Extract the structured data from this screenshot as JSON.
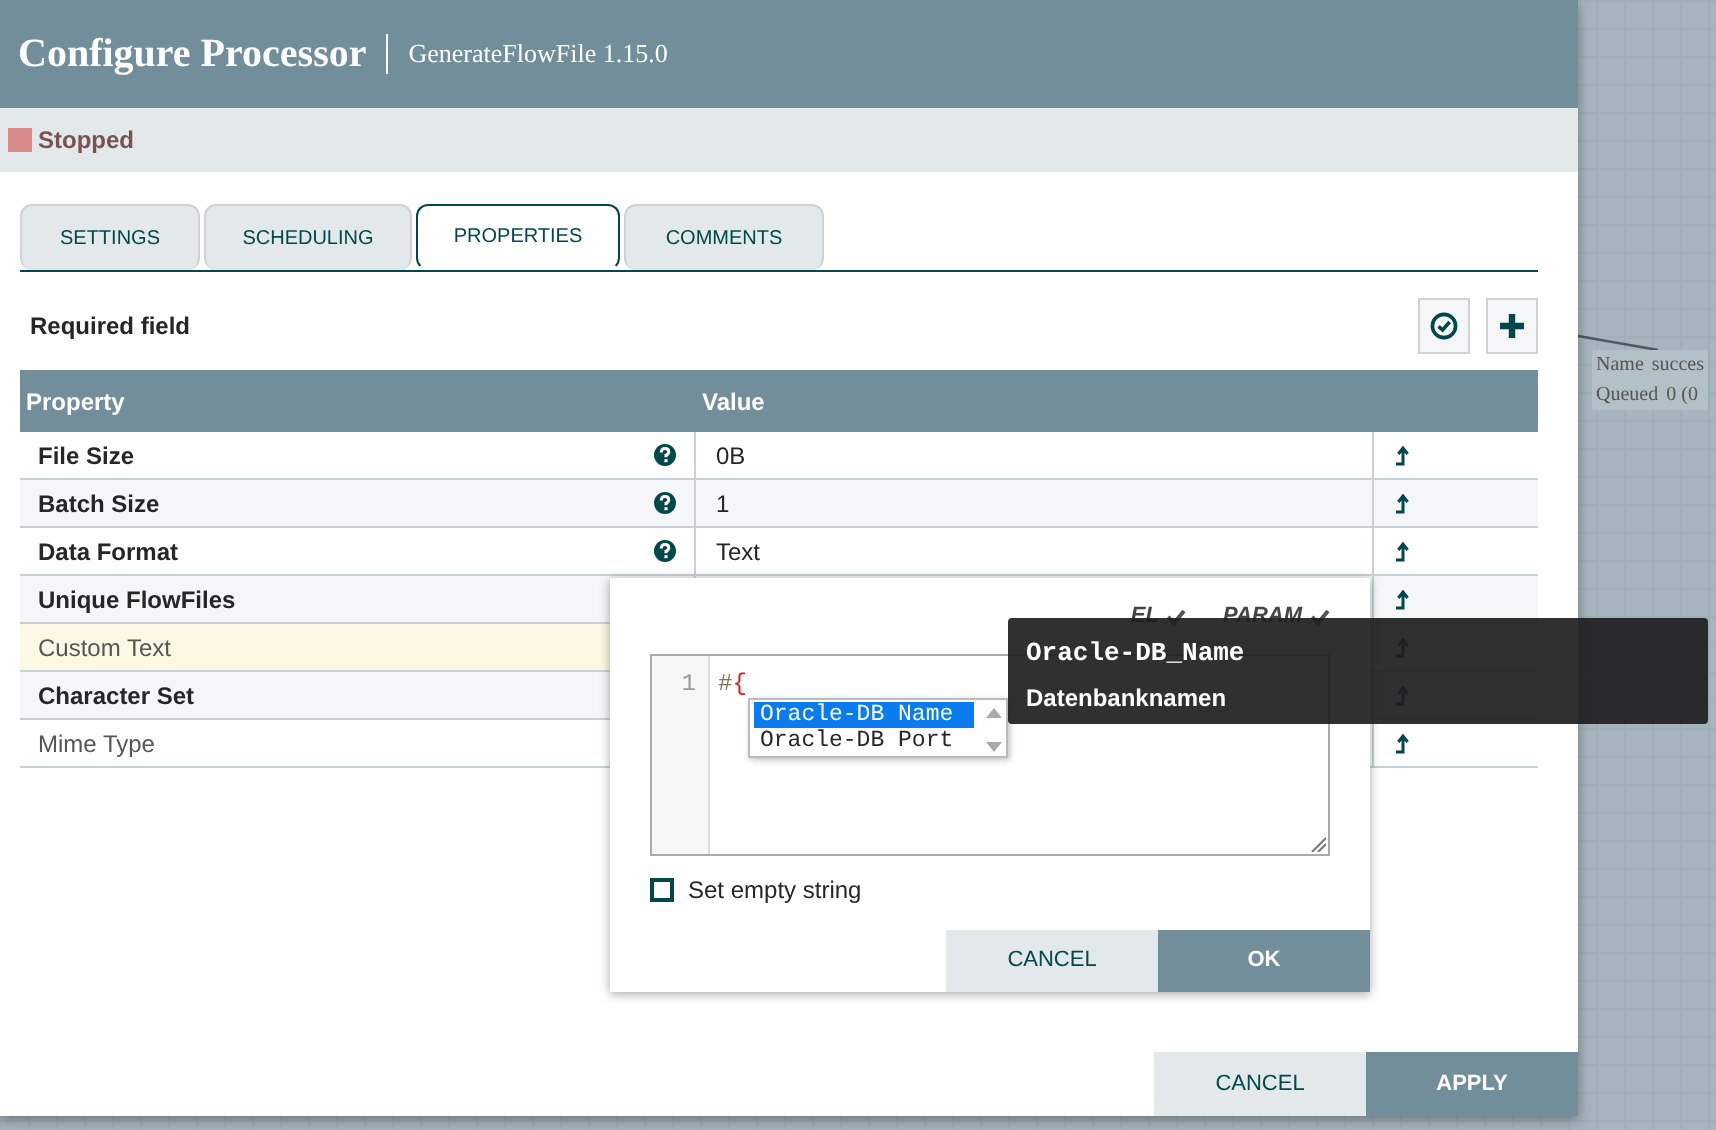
{
  "dialog": {
    "title": "Configure Processor",
    "subtitle": "GenerateFlowFile 1.15.0"
  },
  "status": {
    "label": "Stopped"
  },
  "tabs": [
    {
      "label": "SETTINGS",
      "selected": false
    },
    {
      "label": "SCHEDULING",
      "selected": false
    },
    {
      "label": "PROPERTIES",
      "selected": true
    },
    {
      "label": "COMMENTS",
      "selected": false
    }
  ],
  "required_note": "Required field",
  "columns": [
    "Property",
    "Value"
  ],
  "rows": [
    {
      "name": "File Size",
      "value": "0B",
      "required": true,
      "help": true,
      "selected": false
    },
    {
      "name": "Batch Size",
      "value": "1",
      "required": true,
      "help": true,
      "selected": false
    },
    {
      "name": "Data Format",
      "value": "Text",
      "required": true,
      "help": true,
      "selected": false
    },
    {
      "name": "Unique FlowFiles",
      "required": true,
      "selected": false
    },
    {
      "name": "Custom Text",
      "required": false,
      "selected": true
    },
    {
      "name": "Character Set",
      "required": true,
      "selected": false
    },
    {
      "name": "Mime Type",
      "required": false,
      "selected": false
    }
  ],
  "editor": {
    "flags": [
      {
        "label": "EL",
        "valid": true
      },
      {
        "label": "PARAM",
        "valid": true
      }
    ],
    "line_numbers": [
      "1"
    ],
    "code_tokens": [
      {
        "text": "#",
        "kind": "operator"
      },
      {
        "text": "{",
        "kind": "bracket"
      }
    ],
    "suggestions": [
      {
        "label": "Oracle-DB Name",
        "selected": true
      },
      {
        "label": "Oracle-DB Port",
        "selected": false
      }
    ],
    "tooltip": {
      "title": "Oracle-DB_Name",
      "description": "Datenbanknamen"
    },
    "empty_string": {
      "label": "Set empty string",
      "checked": false
    },
    "buttons": [
      {
        "label": "CANCEL",
        "kind": "secondary"
      },
      {
        "label": "OK",
        "kind": "primary"
      }
    ]
  },
  "footer_buttons": [
    {
      "label": "CANCEL",
      "kind": "secondary"
    },
    {
      "label": "APPLY",
      "kind": "primary"
    }
  ],
  "canvas": {
    "labels": [
      {
        "key": "Name",
        "value": "succes"
      },
      {
        "key": "Queued",
        "value": "0 (0"
      }
    ]
  }
}
